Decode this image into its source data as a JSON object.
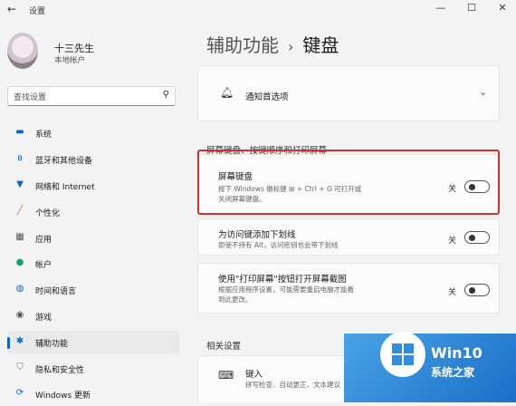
{
  "window": {
    "title": "设置"
  },
  "profile": {
    "name": "十三先生",
    "account": "本地帐户"
  },
  "search": {
    "placeholder": "查找设置"
  },
  "nav": [
    {
      "label": "系统",
      "icon": "display-icon"
    },
    {
      "label": "蓝牙和其他设备",
      "icon": "bluetooth-icon"
    },
    {
      "label": "网络和 Internet",
      "icon": "wifi-icon"
    },
    {
      "label": "个性化",
      "icon": "brush-icon"
    },
    {
      "label": "应用",
      "icon": "apps-icon"
    },
    {
      "label": "帐户",
      "icon": "person-icon"
    },
    {
      "label": "时间和语言",
      "icon": "globe-icon"
    },
    {
      "label": "游戏",
      "icon": "gamepad-icon"
    },
    {
      "label": "辅助功能",
      "icon": "accessibility-icon",
      "active": true
    },
    {
      "label": "隐私和安全性",
      "icon": "shield-icon"
    },
    {
      "label": "Windows 更新",
      "icon": "update-icon"
    }
  ],
  "breadcrumb": {
    "parent": "辅助功能",
    "separator": "›",
    "current": "键盘"
  },
  "notifications": {
    "label": "通知首选项"
  },
  "section_keyboard": "屏幕键盘、按键顺序和打印屏幕",
  "settings": [
    {
      "title": "屏幕键盘",
      "desc1": "按下 Windows 徽标键 ⊞ + Ctrl + O 可打开或",
      "desc2": "关闭屏幕键盘。",
      "state": "关"
    },
    {
      "title": "为访问键添加下划线",
      "desc1": "即使不持有 Alt，访问密钥也会带下划线",
      "desc2": "",
      "state": "关"
    },
    {
      "title": "使用\"打印屏幕\"按钮打开屏幕截图",
      "desc1": "根据应用程序设置，可能需要重启电脑才能看",
      "desc2": "到此更改。",
      "state": "关"
    }
  ],
  "section_related": "相关设置",
  "related": [
    {
      "title": "键入",
      "desc": "拼写检查、自动更正、文本建议"
    }
  ],
  "watermark": {
    "line1": "Win10",
    "line2": "系统之家"
  },
  "colors": {
    "accent": "#0a64c8",
    "highlight": "#d3312b",
    "background": "#f3f3f3"
  }
}
